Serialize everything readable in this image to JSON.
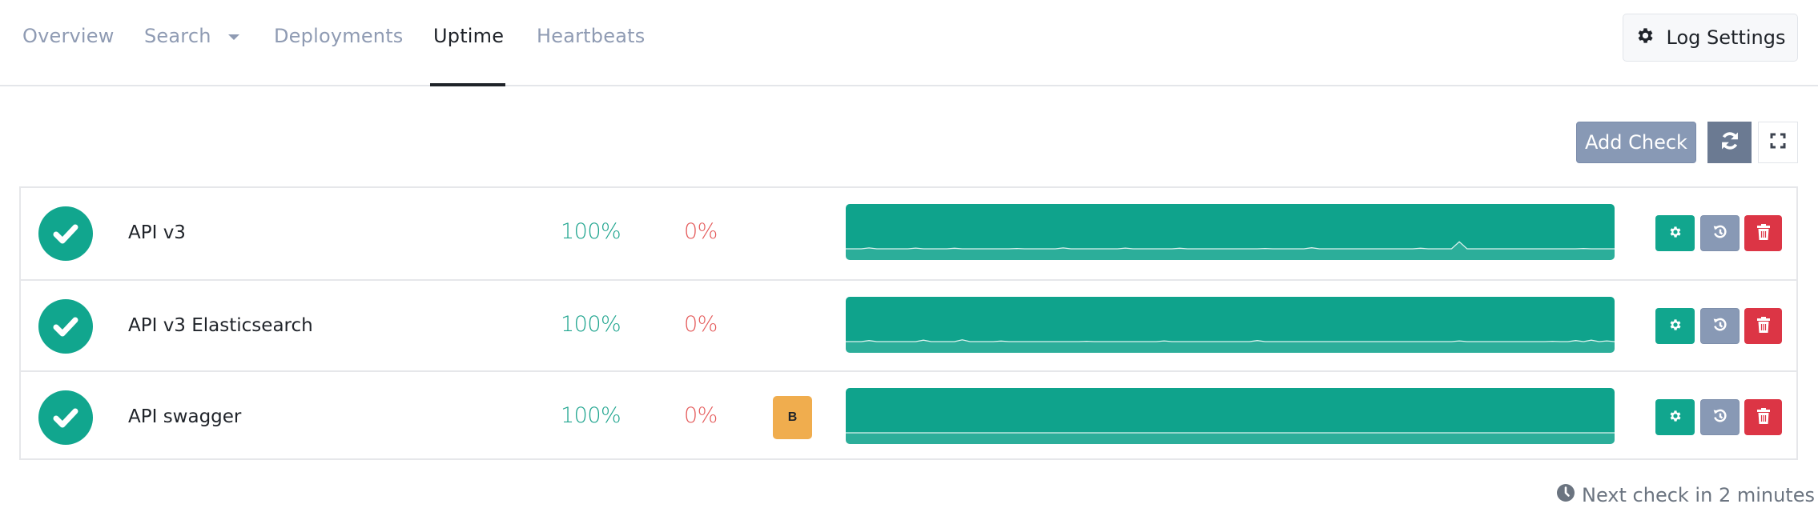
{
  "nav": {
    "tabs": [
      {
        "label": "Overview",
        "active": false
      },
      {
        "label": "Search",
        "active": false,
        "has_dropdown": true
      },
      {
        "label": "Deployments",
        "active": false
      },
      {
        "label": "Uptime",
        "active": true
      },
      {
        "label": "Heartbeats",
        "active": false
      }
    ],
    "log_settings_label": "Log Settings",
    "log_settings_icon": "gear-icon"
  },
  "toolbar": {
    "add_check_label": "Add Check",
    "refresh_icon": "refresh-icon",
    "fullscreen_icon": "expand-icon"
  },
  "checks": [
    {
      "name": "API v3",
      "status": "up",
      "status_icon": "check-circle-icon",
      "uptime": "100%",
      "downtime": "0%",
      "badge": null,
      "sparkline": [
        2,
        2,
        2,
        2.5,
        2,
        2,
        2,
        2,
        2,
        2.4,
        2,
        2,
        2,
        2,
        2.3,
        2,
        2,
        2,
        2,
        2,
        2,
        2,
        2.2,
        2,
        2,
        2,
        2,
        2,
        2.5,
        2,
        2,
        2,
        2,
        2,
        2,
        2,
        2.4,
        2,
        2,
        2,
        2,
        2,
        2,
        2.3,
        2,
        2,
        2,
        2,
        2,
        2,
        2,
        2,
        2,
        2,
        2.2,
        2,
        2,
        2,
        2,
        2,
        2.6,
        2,
        2,
        2,
        2,
        2,
        2,
        2,
        2,
        2,
        2,
        2,
        2,
        2,
        2.3,
        2,
        2,
        2,
        2,
        6,
        2,
        2,
        2,
        2,
        2,
        2,
        2,
        2,
        2,
        2,
        2,
        2,
        2,
        2,
        2,
        2.2,
        2,
        2,
        2,
        2
      ]
    },
    {
      "name": "API v3 Elasticsearch",
      "status": "up",
      "status_icon": "check-circle-icon",
      "uptime": "100%",
      "downtime": "0%",
      "badge": null,
      "sparkline": [
        2,
        2,
        2,
        2.6,
        2,
        2,
        2,
        2,
        2,
        2,
        2.8,
        2,
        2,
        2,
        2,
        3,
        2,
        2,
        2,
        2,
        2.3,
        2,
        2,
        2,
        2,
        2,
        2,
        2,
        2,
        2,
        2,
        2.2,
        2,
        2,
        2,
        2,
        2,
        2,
        2,
        2,
        2,
        2.4,
        2,
        2,
        2,
        2,
        2,
        2,
        2,
        2,
        2,
        2,
        2,
        2.6,
        2,
        2,
        2,
        2,
        2,
        2,
        2,
        2,
        2,
        2,
        2,
        2,
        2,
        2,
        2,
        2,
        2,
        2,
        2,
        2,
        2,
        2,
        2,
        2,
        2,
        2.4,
        2,
        2,
        2,
        2,
        2,
        2,
        2,
        2,
        2,
        2,
        2,
        2.2,
        2,
        2,
        2.6,
        2,
        2.8,
        2,
        2.4,
        2
      ]
    },
    {
      "name": "API swagger",
      "status": "up",
      "status_icon": "check-circle-icon",
      "uptime": "100%",
      "downtime": "0%",
      "badge": "B",
      "sparkline": [
        2,
        2,
        2,
        2,
        2,
        2,
        2,
        2,
        2,
        2,
        2,
        2,
        2,
        2,
        2,
        2,
        2,
        2,
        2,
        2,
        2,
        2,
        2,
        2,
        2,
        2,
        2,
        2,
        2,
        2,
        2,
        2,
        2,
        2,
        2,
        2,
        2,
        2,
        2,
        2,
        2,
        2,
        2,
        2,
        2,
        2,
        2,
        2,
        2,
        2,
        2,
        2,
        2,
        2,
        2,
        2,
        2,
        2,
        2,
        2,
        2,
        2,
        2,
        2,
        2,
        2,
        2,
        2,
        2,
        2,
        2,
        2,
        2,
        2,
        2,
        2,
        2,
        2,
        2,
        2,
        2,
        2,
        2,
        2,
        2,
        2,
        2,
        2,
        2,
        2,
        2,
        2,
        2,
        2,
        2,
        2,
        2,
        2,
        2,
        2
      ]
    }
  ],
  "row_actions": {
    "settings_icon": "gear-icon",
    "history_icon": "history-icon",
    "delete_icon": "trash-icon"
  },
  "colors": {
    "success": "#11a68e",
    "danger": "#dc3545",
    "muted": "#8899b5",
    "warning": "#f0ad4e",
    "downtime_text": "#e45b5b"
  },
  "footer": {
    "next_check_text": "Next check in 2 minutes",
    "icon": "clock-icon"
  }
}
